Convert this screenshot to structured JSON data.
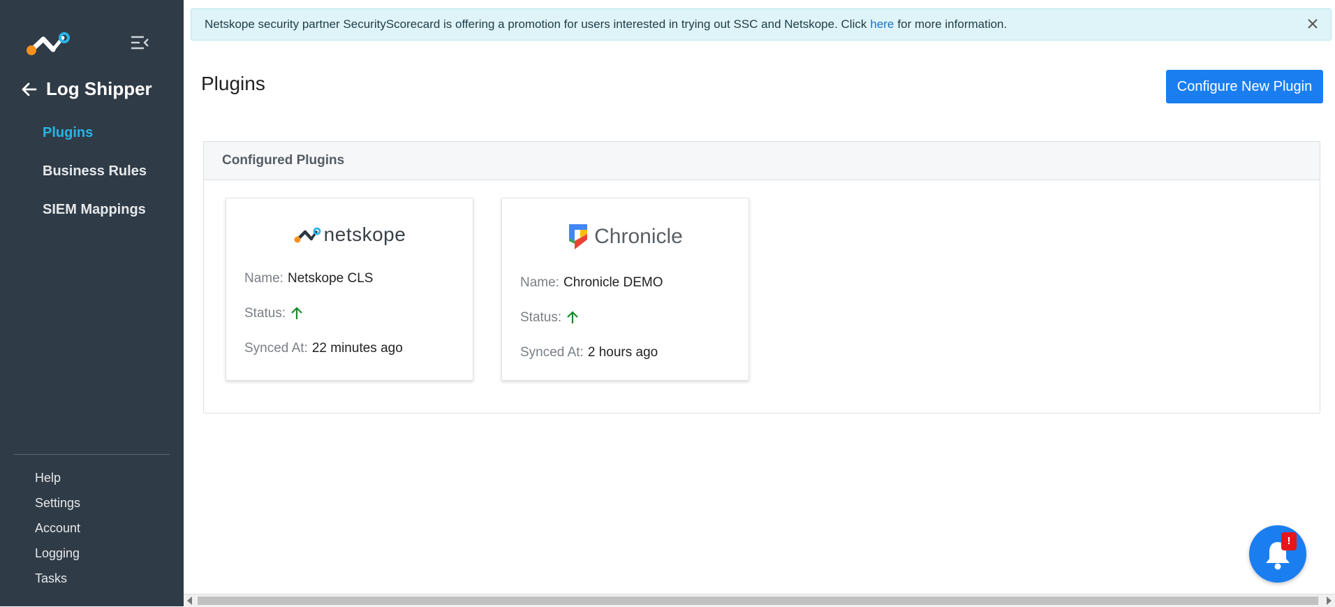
{
  "sidebar": {
    "back_title": "Log Shipper",
    "nav": [
      {
        "label": "Plugins",
        "active": true
      },
      {
        "label": "Business Rules",
        "active": false
      },
      {
        "label": "SIEM Mappings",
        "active": false
      }
    ],
    "bottom": [
      "Help",
      "Settings",
      "Account",
      "Logging",
      "Tasks"
    ]
  },
  "banner": {
    "text_before": "Netskope security partner SecurityScorecard is offering a promotion for users interested in trying out SSC and Netskope. Click",
    "link": "here",
    "text_after": "for more information."
  },
  "page": {
    "title": "Plugins",
    "configure_label": "Configure New Plugin"
  },
  "panel": {
    "header": "Configured Plugins",
    "cards": [
      {
        "logo_text": "netskope",
        "name_label": "Name:",
        "name": "Netskope CLS",
        "status_label": "Status:",
        "synced_label": "Synced At:",
        "synced": "22 minutes ago",
        "status_icon": "arrow-up-icon"
      },
      {
        "logo_text": "Chronicle",
        "name_label": "Name:",
        "name": "Chronicle DEMO",
        "status_label": "Status:",
        "synced_label": "Synced At:",
        "synced": "2 hours ago",
        "status_icon": "arrow-up-icon"
      }
    ]
  },
  "notification": {
    "badge": "!"
  },
  "colors": {
    "sidebar_bg": "#2f3b46",
    "accent": "#1a7ef0",
    "active_nav": "#27b4e6",
    "status_up": "#1a8a2a",
    "badge": "#e8151b"
  }
}
